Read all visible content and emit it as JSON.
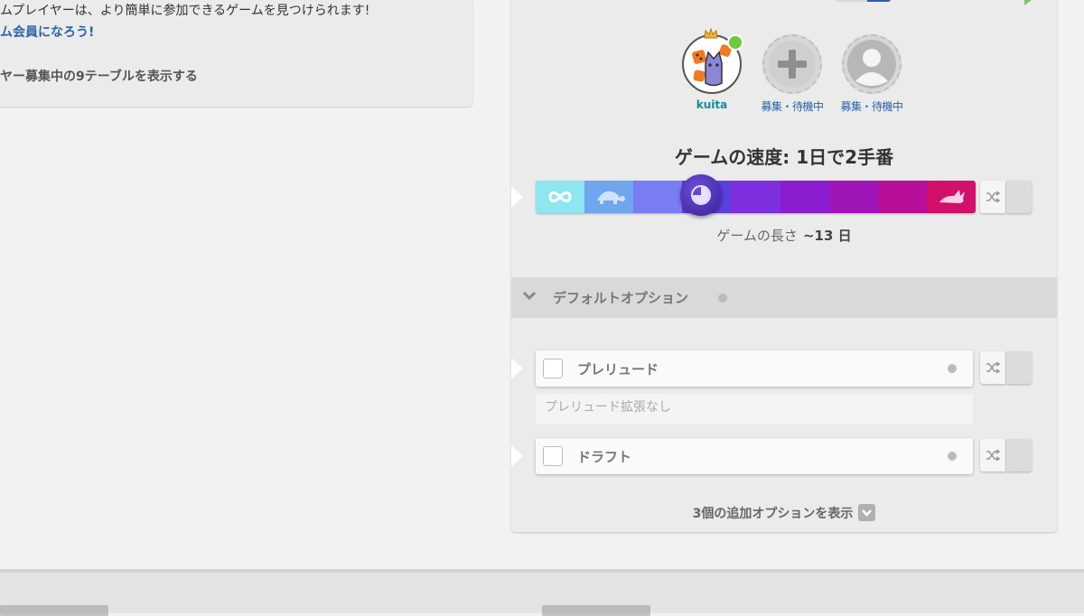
{
  "info_panel": {
    "line1": "ムプレイヤーは、より簡単に参加できるゲームを見つけられます!",
    "line2": "ム会員になろう!",
    "line3": "ヤー募集中の9テーブルを表示する"
  },
  "players": [
    {
      "name": "kuita",
      "type": "user",
      "icon": "cat-avatar-icon"
    },
    {
      "name": "募集・待機中",
      "type": "open-slot",
      "icon": "plus-icon"
    },
    {
      "name": "募集・待機中",
      "type": "waiting",
      "icon": "user-silhouette-icon"
    }
  ],
  "speed": {
    "title": "ゲームの速度: 1日で2手番",
    "selected_index": 3,
    "segment_colors": [
      "#8ee6f0",
      "#6fa6ee",
      "#7a7cf2",
      "#5b3fe0",
      "#7e2fe0",
      "#8a1dd0",
      "#a015b8",
      "#b80e9a",
      "#d0106a"
    ],
    "left_icon": "infinity-icon",
    "slow_icon": "turtle-icon",
    "fast_icon": "rabbit-icon",
    "knob_icon": "clock-icon"
  },
  "game_length": {
    "label": "ゲームの長さ",
    "value": "~13 日"
  },
  "default_options": {
    "title": "デフォルトオプション",
    "options": [
      {
        "label": "プレリュード",
        "description": "プレリュード拡張なし",
        "checked": false
      },
      {
        "label": "ドラフト",
        "checked": false
      }
    ]
  },
  "more_options_label": "3個の追加オプションを表示",
  "icons": [
    "shuffle-icon",
    "chevron-down-icon",
    "crown-icon"
  ]
}
